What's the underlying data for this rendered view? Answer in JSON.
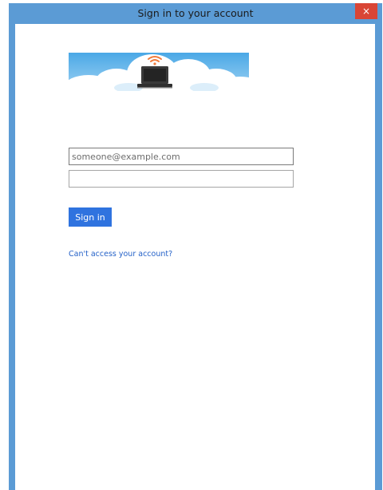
{
  "window": {
    "title": "Sign in to your account",
    "close_glyph": "×"
  },
  "banner": {
    "icon": "laptop-wifi-cloud-icon"
  },
  "form": {
    "email_placeholder": "someone@example.com",
    "email_value": "",
    "password_value": "",
    "signin_label": "Sign in",
    "help_link": "Can't access your account?"
  },
  "colors": {
    "window_frame": "#5b9bd5",
    "close_button": "#d94535",
    "primary_button": "#2f73df",
    "link": "#2461c8"
  }
}
